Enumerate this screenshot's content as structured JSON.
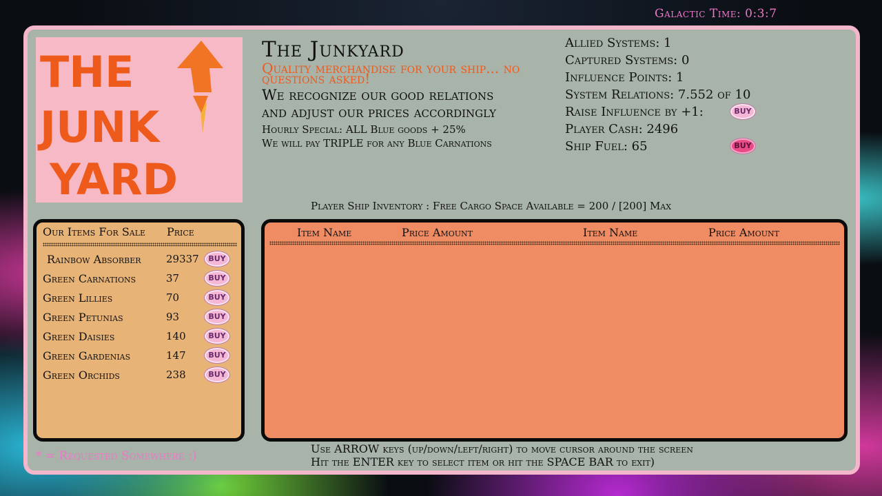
{
  "galactic_time": "Galactic Time: 0:3:7",
  "logo": {
    "lines": [
      "THE",
      "JUNK",
      "YARD"
    ],
    "text_color": "#ee5a1c",
    "background": "#f8b9c7"
  },
  "shop": {
    "title": "The Junkyard",
    "tagline": "Quality merchandise for your ship... no questions asked!",
    "relations_line1": "We recognize our good relations",
    "relations_line2": "and adjust our prices accordingly",
    "hourly_special": "Hourly Special: ALL Blue goods + 25%",
    "triple_offer": "We will pay TRIPLE for any Blue Carnations"
  },
  "stats": {
    "allied_systems": "Allied Systems: 1",
    "captured_systems": "Captured Systems: 0",
    "influence_points": "Influence Points: 1",
    "system_relations": "System Relations: 7.552 of 10",
    "raise_influence": "Raise Influence by +1:",
    "player_cash": "Player Cash: 2496",
    "ship_fuel": "Ship Fuel: 65"
  },
  "buy_label": "BUY",
  "sale_panel": {
    "header_name": "Our Items For Sale",
    "header_price": "Price",
    "items": [
      {
        "name": "Rainbow Absorber",
        "price": "29337"
      },
      {
        "name": "Green Carnations",
        "price": "37"
      },
      {
        "name": "Green Lillies",
        "price": "70"
      },
      {
        "name": "Green Petunias",
        "price": "93"
      },
      {
        "name": "Green Daisies",
        "price": "140"
      },
      {
        "name": "Green Gardenias",
        "price": "147"
      },
      {
        "name": "Green Orchids",
        "price": "238"
      }
    ]
  },
  "requested_note": "* = Requested Somewhere :)",
  "inventory": {
    "caption": "Player Ship Inventory  :  Free Cargo Space Available = 200  /  [200] Max",
    "col1_name": "Item Name",
    "col1_price": "Price Amount",
    "col2_name": "Item Name",
    "col2_price": "Price Amount",
    "items": []
  },
  "instructions": {
    "line1": "Use ARROW keys (up/down/left/right) to move cursor around the screen",
    "line2": "Hit the ENTER key to select item or hit the SPACE BAR to exit)"
  },
  "colors": {
    "frame_border": "#f3b6cb",
    "frame_bg": "#a8b3a9",
    "sale_panel_bg": "#e8b377",
    "inventory_panel_bg": "#f08c64",
    "accent_pink": "#ee78c8",
    "tagline_orange": "#ee5a1c"
  }
}
